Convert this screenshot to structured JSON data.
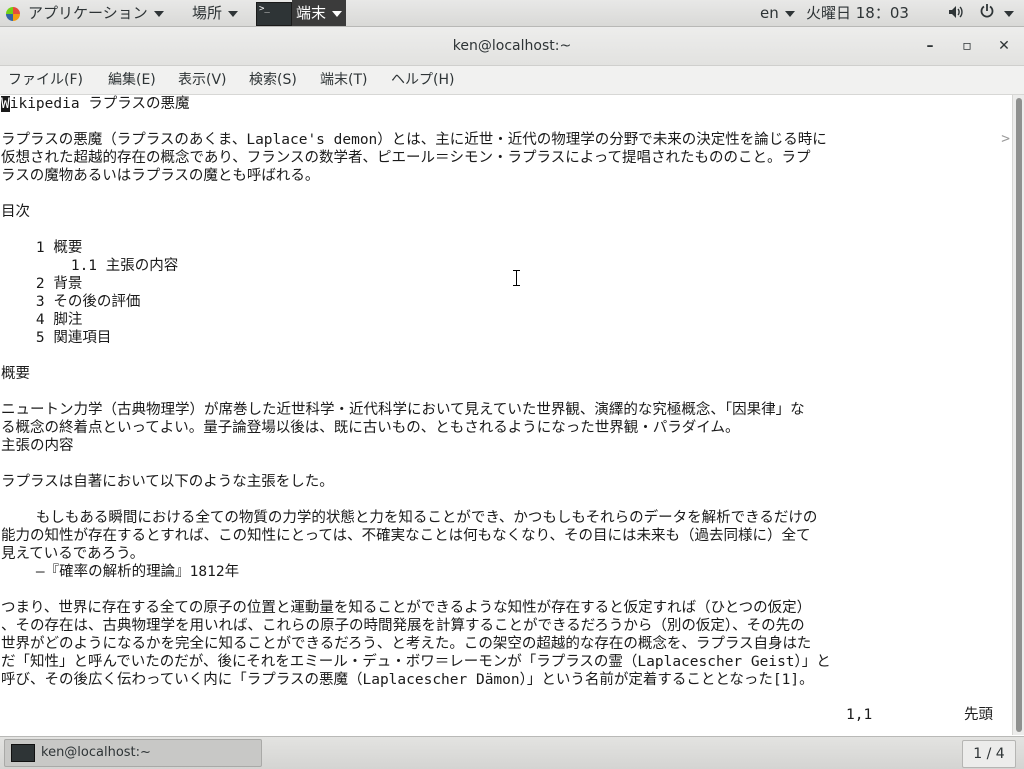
{
  "topbar": {
    "applications": "アプリケーション",
    "places": "場所",
    "terminal": "端末",
    "lang": "en",
    "clock": "火曜日 18：03",
    "icons": [
      "volume-icon",
      "power-icon"
    ]
  },
  "window": {
    "title": "ken@localhost:~",
    "minimize": "–",
    "maximize": "▫",
    "close": "✕"
  },
  "menu": {
    "items": [
      "ファイル(F)",
      "編集(E)",
      "表示(V)",
      "検索(S)",
      "端末(T)",
      "ヘルプ(H)"
    ]
  },
  "terminal": {
    "cursor_char": "W",
    "lines": [
      "ikipedia ラプラスの悪魔",
      "",
      "ラプラスの悪魔（ラプラスのあくま、Laplace's demon）とは、主に近世・近代の物理学の分野で未来の決定性を論じる時に",
      "仮想された超越的存在の概念であり、フランスの数学者、ピエール＝シモン・ラプラスによって提唱されたもののこと。ラプ",
      "ラスの魔物あるいはラプラスの魔とも呼ばれる。",
      "",
      "目次",
      "",
      "    1 概要",
      "        1.1 主張の内容",
      "    2 背景",
      "    3 その後の評価",
      "    4 脚注",
      "    5 関連項目",
      "",
      "概要",
      "",
      "ニュートン力学（古典物理学）が席巻した近世科学・近代科学において見えていた世界観、演繹的な究極概念、「因果律」な",
      "る概念の終着点といってよい。量子論登場以後は、既に古いもの、ともされるようになった世界観・パラダイム。",
      "主張の内容",
      "",
      "ラプラスは自著において以下のような主張をした。",
      "",
      "    もしもある瞬間における全ての物質の力学的状態と力を知ることができ、かつもしもそれらのデータを解析できるだけの",
      "能力の知性が存在するとすれば、この知性にとっては、不確実なことは何もなくなり、その目には未来も（過去同様に）全て",
      "見えているであろう。",
      "    —『確率の解析的理論』1812年",
      "",
      "つまり、世界に存在する全ての原子の位置と運動量を知ることができるような知性が存在すると仮定すれば（ひとつの仮定）",
      "、その存在は、古典物理学を用いれば、これらの原子の時間発展を計算することができるだろうから（別の仮定）、その先の",
      "世界がどのようになるかを完全に知ることができるだろう、と考えた。この架空の超越的な存在の概念を、ラプラス自身はた",
      "だ「知性」と呼んでいたのだが、後にそれをエミール・デュ・ボワ＝レーモンが「ラプラスの霊（Laplacescher Geist）」と",
      "呼び、その後広く伝わっていく内に「ラプラスの悪魔（Laplacescher Dämon）」という名前が定着することとなった[1]。"
    ],
    "overflow_mark": ">",
    "status_position": "1,1",
    "status_percent": "先頭"
  },
  "taskbar": {
    "task_label": "ken@localhost:~",
    "workspace": "1 / 4"
  }
}
